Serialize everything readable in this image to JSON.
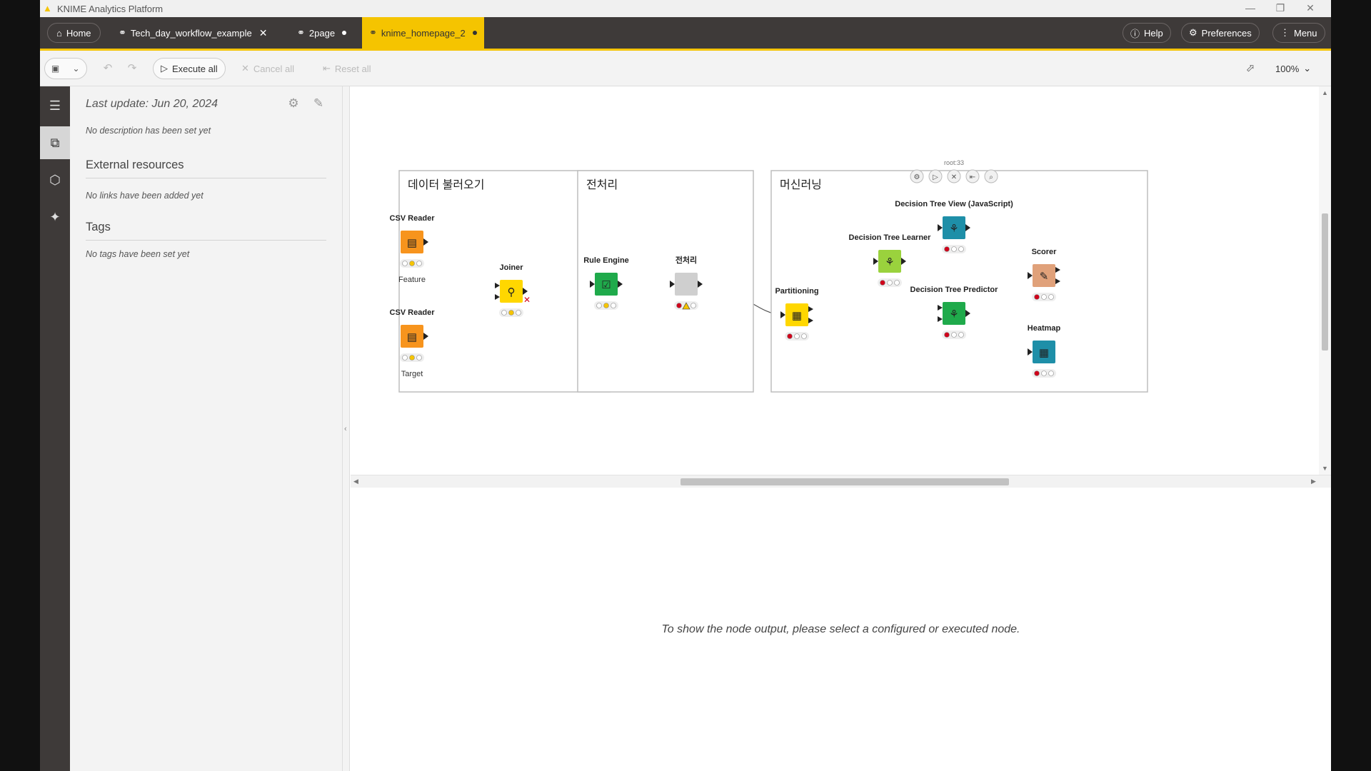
{
  "window": {
    "title": "KNIME Analytics Platform",
    "minimize": "—",
    "restore": "❐",
    "close": "✕"
  },
  "tabbar": {
    "home_label": "Home",
    "tabs": [
      {
        "label": "Tech_day_workflow_example",
        "close": "✕"
      },
      {
        "label": "2page"
      },
      {
        "label": "knime_homepage_2"
      }
    ],
    "help_label": "Help",
    "preferences_label": "Preferences",
    "menu_label": "Menu"
  },
  "toolbar": {
    "execute_all": "Execute all",
    "cancel_all": "Cancel all",
    "reset_all": "Reset all",
    "zoom": "100%"
  },
  "sidepanel": {
    "last_update": "Last update: Jun 20, 2024",
    "description": "No description has been set yet",
    "external_resources_title": "External resources",
    "external_resources_empty": "No links have been added yet",
    "tags_title": "Tags",
    "tags_empty": "No tags have been set yet"
  },
  "workflow": {
    "annotations": [
      {
        "title": "데이터 불러오기"
      },
      {
        "title": "전처리"
      },
      {
        "title": "머신러닝"
      }
    ],
    "nodes": {
      "csv_reader_1": {
        "name": "CSV Reader",
        "label": "Feature",
        "color": "#f7941d"
      },
      "csv_reader_2": {
        "name": "CSV Reader",
        "label": "Target",
        "color": "#f7941d"
      },
      "joiner": {
        "name": "Joiner",
        "color": "#ffd700"
      },
      "rule_engine": {
        "name": "Rule Engine",
        "color": "#1faa4b"
      },
      "preprocess": {
        "name": "전처리",
        "color": "#cfcfcf"
      },
      "partitioning": {
        "name": "Partitioning",
        "color": "#ffd700"
      },
      "dt_learner": {
        "name": "Decision Tree Learner",
        "color": "#9ad23d"
      },
      "dt_view": {
        "name": "Decision Tree View (JavaScript)",
        "color": "#1e8fa8"
      },
      "dt_predictor": {
        "name": "Decision Tree Predictor",
        "color": "#1faa4b"
      },
      "scorer": {
        "name": "Scorer",
        "color": "#e0a17a"
      },
      "heatmap": {
        "name": "Heatmap",
        "color": "#1e8fa8"
      }
    },
    "selected_node_hover_label": "root:33"
  },
  "output": {
    "message": "To show the node output, please select a configured or executed node."
  },
  "colors": {
    "accent": "#f5c400",
    "tabbar_bg": "#3e3a39",
    "status_red": "#d0021b",
    "status_yellow": "#f5c400",
    "status_green": "#1faa4b"
  }
}
